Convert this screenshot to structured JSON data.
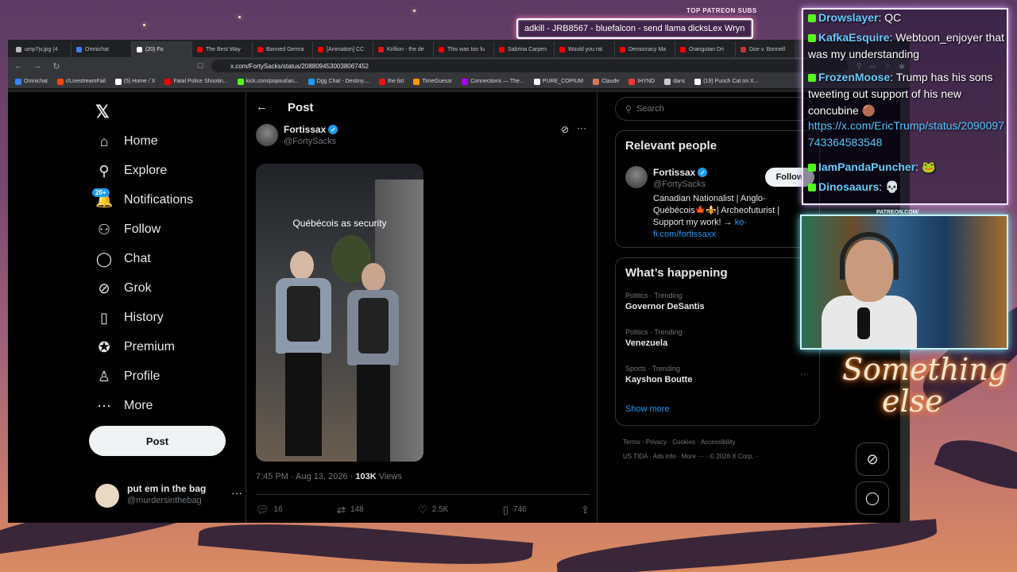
{
  "stream": {
    "top_label": "TOP PATREON SUBS",
    "ticker": "adkill - JRB8567 - bluefalcon - send llama dicksLex Wryn",
    "patreon_label": "PATREON.COM/",
    "neon_line1": "Something",
    "neon_line2": "else"
  },
  "browser": {
    "tabs": [
      {
        "label": "ump7jv.jpg (4",
        "color": "#bbb"
      },
      {
        "label": "Omnichat",
        "color": "#3b82f6"
      },
      {
        "label": "(20) Fo",
        "color": "#fff",
        "active": true
      },
      {
        "label": "The Best Way",
        "color": "#ff0000"
      },
      {
        "label": "Banned Germa",
        "color": "#ff0000"
      },
      {
        "label": "[Animation] CC",
        "color": "#ff0000"
      },
      {
        "label": "Krillion - the de",
        "color": "#e11"
      },
      {
        "label": "This was too fu",
        "color": "#ff0000"
      },
      {
        "label": "Sabrina Carpen",
        "color": "#ff0000"
      },
      {
        "label": "Would you rat",
        "color": "#ff0000"
      },
      {
        "label": "Democracy Ma",
        "color": "#ff0000"
      },
      {
        "label": "Orangutan Dri",
        "color": "#ff0000"
      },
      {
        "label": "Doe v. Bonnell",
        "color": "#c33"
      }
    ],
    "url": "x.com/FortySacks/status/2088094530038067452",
    "bookmarks": [
      "Omnichat",
      "r/LivestreamFail",
      "(5) Home / X",
      "Fatal Police Shootin...",
      "kick.com/popout/an...",
      "Dgg Chat - Destiny....",
      "the list",
      "TimeGuessr",
      "Connections — The...",
      "PURE_COPIUM",
      "Claude",
      "IHYND",
      "dans",
      "(19) Punch Cat on X..."
    ]
  },
  "nav": {
    "items": [
      {
        "icon": "⌂",
        "label": "Home"
      },
      {
        "icon": "⚲",
        "label": "Explore"
      },
      {
        "icon": "🔔",
        "label": "Notifications"
      },
      {
        "icon": "⚇",
        "label": "Follow"
      },
      {
        "icon": "◯",
        "label": "Chat"
      },
      {
        "icon": "⊘",
        "label": "Grok"
      },
      {
        "icon": "▯",
        "label": "History"
      },
      {
        "icon": "✪",
        "label": "Premium"
      },
      {
        "icon": "♙",
        "label": "Profile"
      },
      {
        "icon": "⋯",
        "label": "More"
      }
    ],
    "notif_badge": "20+",
    "post_label": "Post",
    "account": {
      "name": "put em in the bag",
      "handle": "@murdersinthebag"
    }
  },
  "post": {
    "header": "Post",
    "author_name": "Fortissax",
    "author_handle": "@FortySacks",
    "caption": "Québécois as security",
    "time": "7:45 PM · Aug 13, 2026 · ",
    "views_count": "103K",
    "views_label": " Views",
    "actions": {
      "replies": "16",
      "reposts": "148",
      "likes": "2.5K",
      "bookmarks": "746"
    }
  },
  "sidebar": {
    "search_placeholder": "Search",
    "relevant_title": "Relevant people",
    "rel_name": "Fortissax",
    "rel_handle": "@FortySacks",
    "follow": "Follow",
    "rel_bio": "Canadian Nationalist | Anglo-Québécois🍁⚜️| Archeofuturist | Support my work! → ",
    "rel_link": "ko-fi.com/fortissaxx",
    "happening_title": "What’s happening",
    "trends": [
      {
        "cat": "Politics · Trending",
        "name": "Governor DeSantis"
      },
      {
        "cat": "Politics · Trending",
        "name": "Venezuela"
      },
      {
        "cat": "Sports · Trending",
        "name": "Kayshon Boutte"
      }
    ],
    "show_more": "Show more",
    "footer": [
      "Terms",
      "Privacy",
      "Cookies",
      "Accessibility",
      "US TIDA",
      "Ads info",
      "More ···",
      "© 2026 X Corp."
    ]
  },
  "chat": [
    {
      "user": "Drowslayer",
      "text": "QC"
    },
    {
      "user": "KafkaEsquire",
      "text": "Webtoon_enjoyer that was my understanding"
    },
    {
      "user": "FrozenMoose",
      "text": "Trump has his sons tweeting out support of his new concubine 🟤"
    },
    {
      "user": "",
      "text": "https://x.com/EricTrump/status/2090097743364583548"
    },
    {
      "user": "IamPandaPuncher",
      "text": "🐸"
    },
    {
      "user": "Dinosaaurs",
      "text": "💀"
    }
  ]
}
